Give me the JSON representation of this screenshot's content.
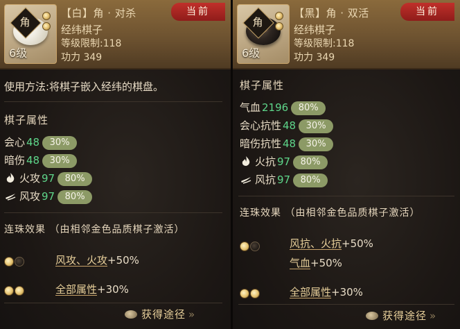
{
  "left": {
    "stone_char": "角",
    "level": "6级",
    "name": "【白】角 · 对杀",
    "type": "经纬棋子",
    "level_limit": "等级限制:118",
    "power": "功力 349",
    "badge": "当前",
    "usage": "使用方法:将棋子嵌入经纬的棋盘。",
    "attr_title": "棋子属性",
    "stats": [
      {
        "label": "会心",
        "value": "48",
        "pct": "30%",
        "icon": ""
      },
      {
        "label": "暗伤",
        "value": "48",
        "pct": "30%",
        "icon": ""
      },
      {
        "label": "火攻",
        "value": "97",
        "pct": "80%",
        "icon": "fire-icon"
      },
      {
        "label": "风攻",
        "value": "97",
        "pct": "80%",
        "icon": "wind-icon"
      }
    ],
    "combo_title": "连珠效果 （由相邻金色品质棋子激活）",
    "combos": [
      {
        "link": "风攻、火攻",
        "bonus": "+50%"
      },
      {
        "link": "全部属性",
        "bonus": "+30%"
      }
    ],
    "obtain": "获得途径"
  },
  "right": {
    "stone_char": "角",
    "level": "6级",
    "name": "【黑】角 · 双活",
    "type": "经纬棋子",
    "level_limit": "等级限制:118",
    "power": "功力 349",
    "badge": "当前",
    "attr_title": "棋子属性",
    "stats": [
      {
        "label": "气血",
        "value": "2196",
        "pct": "80%",
        "icon": ""
      },
      {
        "label": "会心抗性",
        "value": "48",
        "pct": "30%",
        "icon": ""
      },
      {
        "label": "暗伤抗性",
        "value": "48",
        "pct": "30%",
        "icon": ""
      },
      {
        "label": "火抗",
        "value": "97",
        "pct": "80%",
        "icon": "fire-icon"
      },
      {
        "label": "风抗",
        "value": "97",
        "pct": "80%",
        "icon": "wind-icon"
      }
    ],
    "combo_title": "连珠效果 （由相邻金色品质棋子激活）",
    "combos": [
      {
        "link": "风抗、火抗",
        "bonus": "+50%",
        "link2": "气血",
        "bonus2": "+50%"
      },
      {
        "link": "全部属性",
        "bonus": "+30%"
      }
    ],
    "obtain": "获得途径"
  },
  "colors": {
    "value_green": "#5ed68a",
    "pct_pill": "#8c9a66",
    "badge_red": "#b02824",
    "gold_text": "#e7cf9a"
  }
}
